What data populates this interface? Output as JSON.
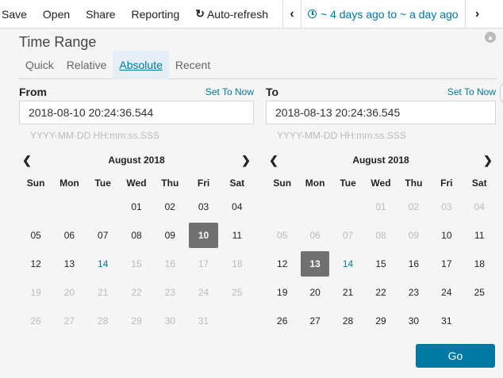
{
  "topbar": {
    "menu": [
      "Save",
      "Open",
      "Share",
      "Reporting"
    ],
    "auto_refresh": "Auto-refresh",
    "time_range_label": "~ 4 days ago to ~ a day ago"
  },
  "panel": {
    "title": "Time Range",
    "tabs": [
      "Quick",
      "Relative",
      "Absolute",
      "Recent"
    ],
    "active_tab": "Absolute"
  },
  "from": {
    "label": "From",
    "set_now": "Set To Now",
    "value": "2018-08-10 20:24:36.544",
    "hint": "YYYY-MM-DD HH:mm:ss.SSS",
    "calendar": {
      "month": "August 2018",
      "weekdays": [
        "Sun",
        "Mon",
        "Tue",
        "Wed",
        "Thu",
        "Fri",
        "Sat"
      ],
      "days": [
        {
          "t": "",
          "s": "blank"
        },
        {
          "t": "",
          "s": "blank"
        },
        {
          "t": "",
          "s": "blank"
        },
        {
          "t": "01",
          "s": "in"
        },
        {
          "t": "02",
          "s": "in"
        },
        {
          "t": "03",
          "s": "in"
        },
        {
          "t": "04",
          "s": "in"
        },
        {
          "t": "05",
          "s": "in"
        },
        {
          "t": "06",
          "s": "in"
        },
        {
          "t": "07",
          "s": "in"
        },
        {
          "t": "08",
          "s": "in"
        },
        {
          "t": "09",
          "s": "in"
        },
        {
          "t": "10",
          "s": "selected"
        },
        {
          "t": "11",
          "s": "in"
        },
        {
          "t": "12",
          "s": "in"
        },
        {
          "t": "13",
          "s": "in"
        },
        {
          "t": "14",
          "s": "today"
        },
        {
          "t": "15",
          "s": "out"
        },
        {
          "t": "16",
          "s": "out"
        },
        {
          "t": "17",
          "s": "out"
        },
        {
          "t": "18",
          "s": "out"
        },
        {
          "t": "19",
          "s": "out"
        },
        {
          "t": "20",
          "s": "out"
        },
        {
          "t": "21",
          "s": "out"
        },
        {
          "t": "22",
          "s": "out"
        },
        {
          "t": "23",
          "s": "out"
        },
        {
          "t": "24",
          "s": "out"
        },
        {
          "t": "25",
          "s": "out"
        },
        {
          "t": "26",
          "s": "out"
        },
        {
          "t": "27",
          "s": "out"
        },
        {
          "t": "28",
          "s": "out"
        },
        {
          "t": "29",
          "s": "out"
        },
        {
          "t": "30",
          "s": "out"
        },
        {
          "t": "31",
          "s": "out"
        }
      ]
    }
  },
  "to": {
    "label": "To",
    "set_now": "Set To Now",
    "value": "2018-08-13 20:24:36.545",
    "hint": "YYYY-MM-DD HH:mm:ss.SSS",
    "calendar": {
      "month": "August 2018",
      "weekdays": [
        "Sun",
        "Mon",
        "Tue",
        "Wed",
        "Thu",
        "Fri",
        "Sat"
      ],
      "days": [
        {
          "t": "",
          "s": "blank"
        },
        {
          "t": "",
          "s": "blank"
        },
        {
          "t": "",
          "s": "blank"
        },
        {
          "t": "01",
          "s": "out"
        },
        {
          "t": "02",
          "s": "out"
        },
        {
          "t": "03",
          "s": "out"
        },
        {
          "t": "04",
          "s": "out"
        },
        {
          "t": "05",
          "s": "out"
        },
        {
          "t": "06",
          "s": "out"
        },
        {
          "t": "07",
          "s": "out"
        },
        {
          "t": "08",
          "s": "out"
        },
        {
          "t": "09",
          "s": "out"
        },
        {
          "t": "10",
          "s": "in"
        },
        {
          "t": "11",
          "s": "in"
        },
        {
          "t": "12",
          "s": "in"
        },
        {
          "t": "13",
          "s": "selected"
        },
        {
          "t": "14",
          "s": "today"
        },
        {
          "t": "15",
          "s": "in"
        },
        {
          "t": "16",
          "s": "in"
        },
        {
          "t": "17",
          "s": "in"
        },
        {
          "t": "18",
          "s": "in"
        },
        {
          "t": "19",
          "s": "in"
        },
        {
          "t": "20",
          "s": "in"
        },
        {
          "t": "21",
          "s": "in"
        },
        {
          "t": "22",
          "s": "in"
        },
        {
          "t": "23",
          "s": "in"
        },
        {
          "t": "24",
          "s": "in"
        },
        {
          "t": "25",
          "s": "in"
        },
        {
          "t": "26",
          "s": "in"
        },
        {
          "t": "27",
          "s": "in"
        },
        {
          "t": "28",
          "s": "in"
        },
        {
          "t": "29",
          "s": "in"
        },
        {
          "t": "30",
          "s": "in"
        },
        {
          "t": "31",
          "s": "in"
        }
      ]
    }
  },
  "go_label": "Go"
}
